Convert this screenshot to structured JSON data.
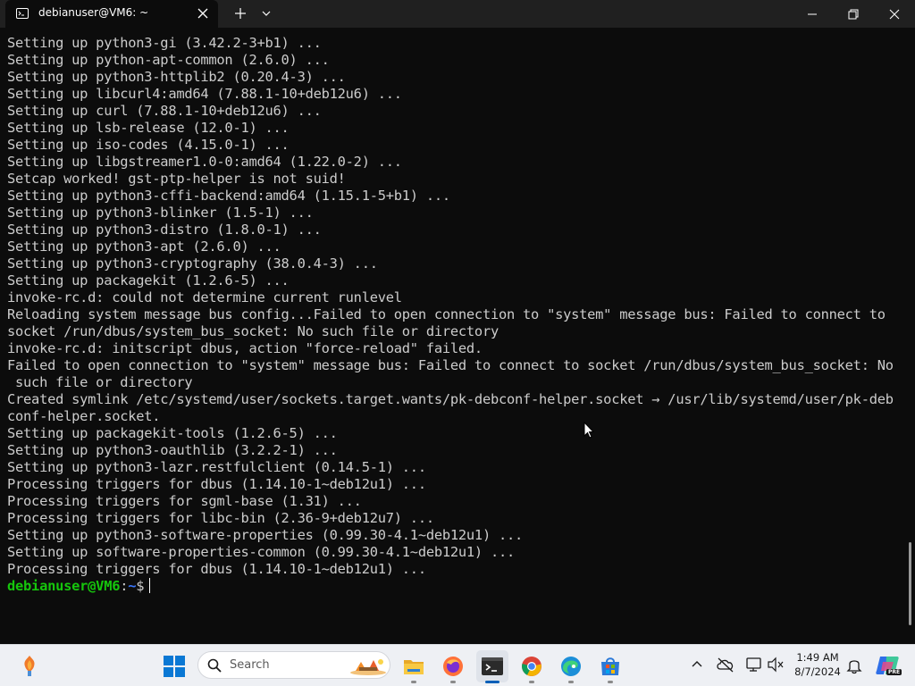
{
  "window": {
    "tab_title": "debianuser@VM6: ~",
    "tab_icon": "terminal-icon",
    "controls": [
      "minimize-icon",
      "maximize-icon",
      "close-icon"
    ]
  },
  "terminal": {
    "lines": [
      "Setting up python3-gi (3.42.2-3+b1) ...",
      "Setting up python-apt-common (2.6.0) ...",
      "Setting up python3-httplib2 (0.20.4-3) ...",
      "Setting up libcurl4:amd64 (7.88.1-10+deb12u6) ...",
      "Setting up curl (7.88.1-10+deb12u6) ...",
      "Setting up lsb-release (12.0-1) ...",
      "Setting up iso-codes (4.15.0-1) ...",
      "Setting up libgstreamer1.0-0:amd64 (1.22.0-2) ...",
      "Setcap worked! gst-ptp-helper is not suid!",
      "Setting up python3-cffi-backend:amd64 (1.15.1-5+b1) ...",
      "Setting up python3-blinker (1.5-1) ...",
      "Setting up python3-distro (1.8.0-1) ...",
      "Setting up python3-apt (2.6.0) ...",
      "Setting up python3-cryptography (38.0.4-3) ...",
      "Setting up packagekit (1.2.6-5) ...",
      "invoke-rc.d: could not determine current runlevel",
      "Reloading system message bus config...Failed to open connection to \"system\" message bus: Failed to connect to",
      "socket /run/dbus/system_bus_socket: No such file or directory",
      "invoke-rc.d: initscript dbus, action \"force-reload\" failed.",
      "Failed to open connection to \"system\" message bus: Failed to connect to socket /run/dbus/system_bus_socket: No",
      " such file or directory",
      "Created symlink /etc/systemd/user/sockets.target.wants/pk-debconf-helper.socket → /usr/lib/systemd/user/pk-deb",
      "conf-helper.socket.",
      "Setting up packagekit-tools (1.2.6-5) ...",
      "Setting up python3-oauthlib (3.2.2-1) ...",
      "Setting up python3-lazr.restfulclient (0.14.5-1) ...",
      "Processing triggers for dbus (1.14.10-1~deb12u1) ...",
      "Processing triggers for sgml-base (1.31) ...",
      "Processing triggers for libc-bin (2.36-9+deb12u7) ...",
      "Setting up python3-software-properties (0.99.30-4.1~deb12u1) ...",
      "Setting up software-properties-common (0.99.30-4.1~deb12u1) ...",
      "Processing triggers for dbus (1.14.10-1~deb12u1) ..."
    ],
    "prompt": {
      "user_host": "debianuser@VM6",
      "separator": ":",
      "path": "~",
      "symbol": "$"
    },
    "colors": {
      "background": "#0c0c0c",
      "text": "#cccccc",
      "prompt_user": "#16c60c",
      "prompt_path": "#3b78ff"
    }
  },
  "taskbar": {
    "search_label": "Search",
    "apps": [
      "widgets-icon",
      "start-icon",
      "file-explorer-icon",
      "firefox-icon",
      "terminal-icon",
      "chrome-icon",
      "edge-icon",
      "store-icon"
    ],
    "tray": [
      "show-hidden-icons-chevron",
      "onedrive-icon",
      "network-icon",
      "volume-icon",
      "notification-bell-icon",
      "copilot-icon"
    ],
    "clock_time": "1:49 AM",
    "clock_date": "8/7/2024",
    "copilot_badge": "PRE"
  }
}
